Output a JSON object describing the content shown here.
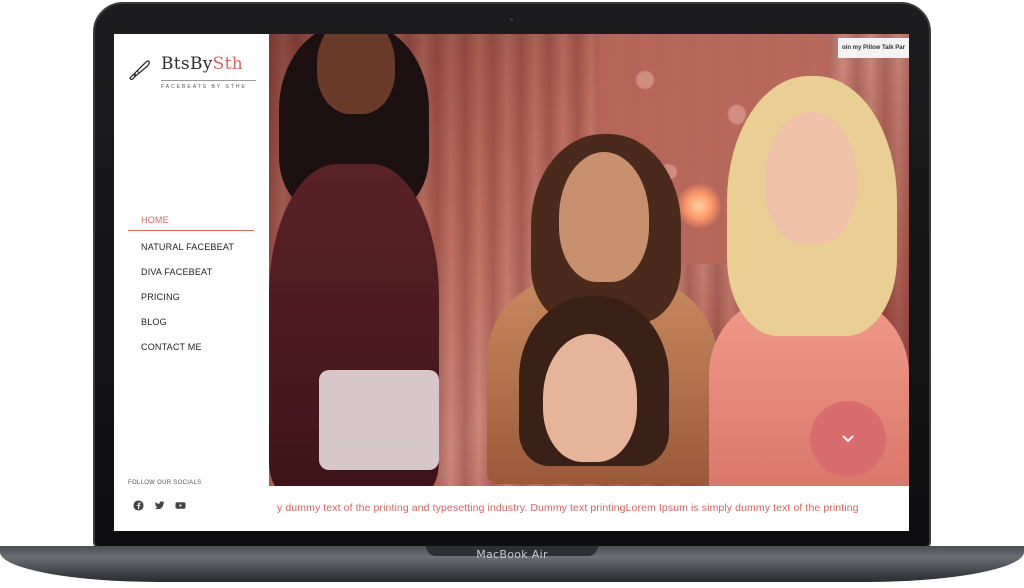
{
  "device": {
    "label": "MacBook Air"
  },
  "brand": {
    "name_part1": "BtsBy",
    "name_part2": "Sth",
    "tagline": "FACEBEATS BY STHE",
    "accent_color": "#d4655f",
    "icon": "makeup-brush-icon"
  },
  "nav": {
    "items": [
      {
        "label": "HOME",
        "active": true
      },
      {
        "label": "NATURAL FACEBEAT",
        "active": false
      },
      {
        "label": "DIVA FACEBEAT",
        "active": false
      },
      {
        "label": "PRICING",
        "active": false
      },
      {
        "label": "BLOG",
        "active": false
      },
      {
        "label": "CONTACT ME",
        "active": false
      }
    ]
  },
  "socials": {
    "label": "FOLLOW OUR SOCIALS",
    "icons": [
      "facebook-icon",
      "twitter-icon",
      "youtube-icon"
    ]
  },
  "hero": {
    "video_title": "oin my Pillow Talk Par",
    "scroll_button_icon": "chevron-down-icon",
    "scroll_button_color": "#d86b6e"
  },
  "marquee": {
    "text": "y dummy text of the printing and typesetting industry. Dummy text printingLorem Ipsum is simply dummy text of the printing"
  }
}
